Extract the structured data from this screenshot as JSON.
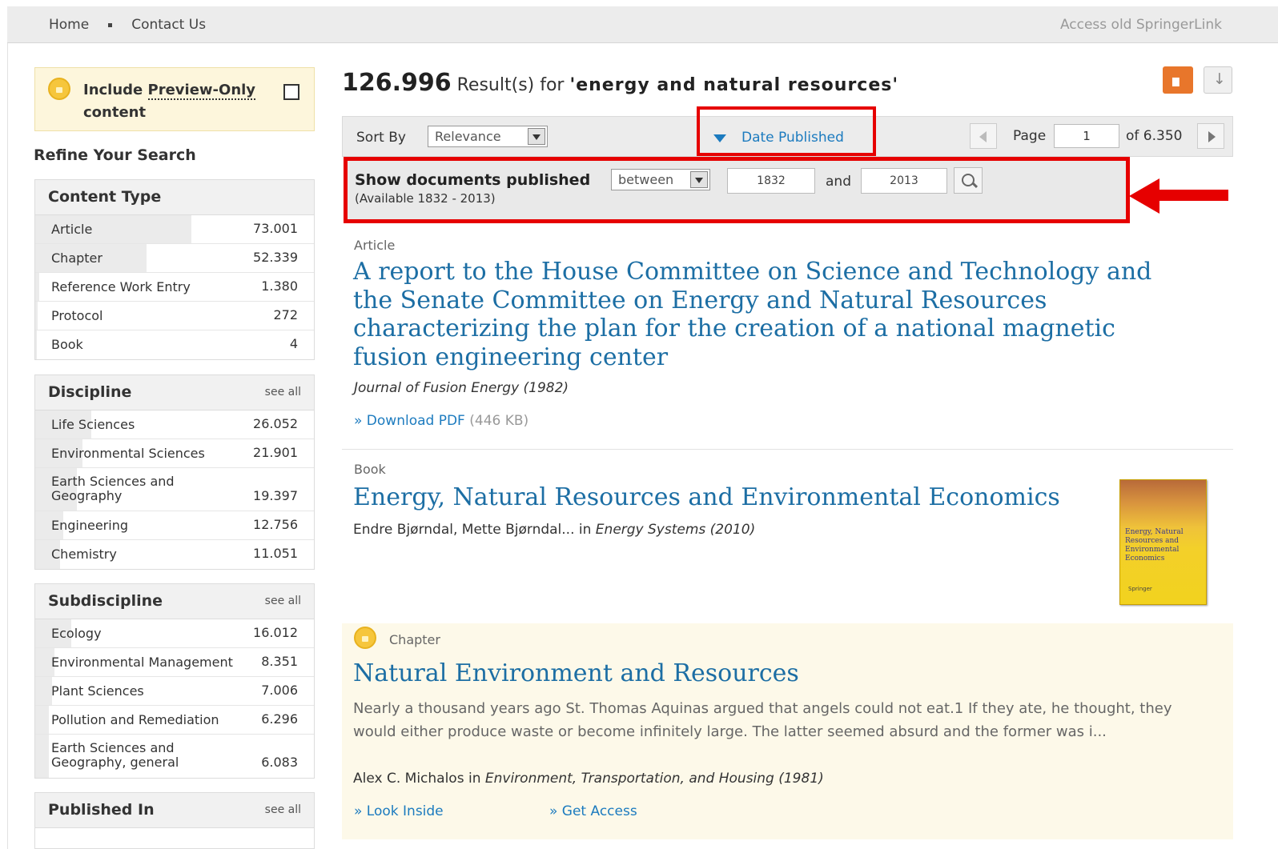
{
  "topnav": {
    "home": "Home",
    "contact": "Contact Us",
    "old": "Access old SpringerLink"
  },
  "sidebar": {
    "preview_prefix": "Include ",
    "preview_link": "Preview-Only",
    "preview_suffix": "content",
    "refine_title": "Refine Your Search",
    "see_all": "see all",
    "content_type": {
      "title": "Content Type",
      "items": [
        {
          "label": "Article",
          "count": "73.001",
          "share": 0.56
        },
        {
          "label": "Chapter",
          "count": "52.339",
          "share": 0.4
        },
        {
          "label": "Reference Work Entry",
          "count": "1.380",
          "share": 0.015
        },
        {
          "label": "Protocol",
          "count": "272",
          "share": 0.01
        },
        {
          "label": "Book",
          "count": "4",
          "share": 0.005
        }
      ]
    },
    "discipline": {
      "title": "Discipline",
      "items": [
        {
          "label": "Life Sciences",
          "count": "26.052",
          "share": 0.2
        },
        {
          "label": "Environmental Sciences",
          "count": "21.901",
          "share": 0.17
        },
        {
          "label": "Earth Sciences and Geography",
          "count": "19.397",
          "share": 0.15
        },
        {
          "label": "Engineering",
          "count": "12.756",
          "share": 0.1
        },
        {
          "label": "Chemistry",
          "count": "11.051",
          "share": 0.09
        }
      ]
    },
    "subdiscipline": {
      "title": "Subdiscipline",
      "items": [
        {
          "label": "Ecology",
          "count": "16.012",
          "share": 0.13
        },
        {
          "label": "Environmental Management",
          "count": "8.351",
          "share": 0.07
        },
        {
          "label": "Plant Sciences",
          "count": "7.006",
          "share": 0.06
        },
        {
          "label": "Pollution and Remediation",
          "count": "6.296",
          "share": 0.05
        },
        {
          "label": "Earth Sciences and Geography, general",
          "count": "6.083",
          "share": 0.05
        }
      ]
    },
    "published_in": {
      "title": "Published In"
    }
  },
  "results": {
    "count": "126.996",
    "label": " Result(s) for ",
    "query": "'energy and natural resources'"
  },
  "sort": {
    "label": "Sort By",
    "value": "Relevance",
    "date_published": "Date Published",
    "page_label": "Page",
    "page": "1",
    "page_of": "of 6.350"
  },
  "date_filter": {
    "label": "Show documents published",
    "mode": "between",
    "available": "(Available 1832 - 2013)",
    "from": "1832",
    "and": "and",
    "to": "2013"
  },
  "items": [
    {
      "type": "Article",
      "title": "A report to the House Committee on Science and Technology and the Senate Committee on Energy and Natural Resources characterizing the plan for the creation of a national magnetic fusion engineering center",
      "source": "Journal of Fusion Energy (1982)",
      "link": "» Download PDF",
      "size": " (446 KB)"
    },
    {
      "type": "Book",
      "title": "Energy, Natural Resources and Environmental Economics",
      "authors": "Endre Bjørndal, Mette Bjørndal... in ",
      "source": "Energy Systems (2010)",
      "cover_text": "Energy, Natural Resources and Environmental Economics",
      "cover_publisher": "Springer"
    },
    {
      "type": "Chapter",
      "title": "Natural Environment and Resources",
      "snippet": "Nearly a thousand years ago St. Thomas Aquinas argued that angels could not eat.1 If they ate, he thought, they would either produce waste or become infinitely large. The latter seemed absurd and the former was i...",
      "authors": "Alex C. Michalos in ",
      "source": "Environment, Transportation, and Housing (1981)",
      "link1": "» Look Inside",
      "link2": "» Get Access"
    }
  ]
}
